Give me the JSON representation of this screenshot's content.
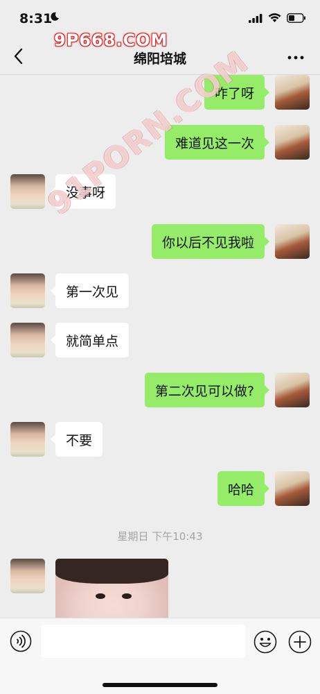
{
  "status_bar": {
    "time": "8:31"
  },
  "watermarks": {
    "top": "9P668.COM",
    "diagonal": "91PORN.COM"
  },
  "nav": {
    "title": "绵阳培城"
  },
  "messages": [
    {
      "side": "right",
      "text": "咋了呀"
    },
    {
      "side": "right",
      "text": "难道见这一次"
    },
    {
      "side": "left",
      "text": "没事呀"
    },
    {
      "side": "right",
      "text": "你以后不见我啦"
    },
    {
      "side": "left",
      "text": "第一次见"
    },
    {
      "side": "left",
      "text": "就简单点"
    },
    {
      "side": "right",
      "text": "第二次见可以做?"
    },
    {
      "side": "left",
      "text": "不要"
    },
    {
      "side": "right",
      "text": "哈哈"
    }
  ],
  "timestamp": "星期日 下午10:43",
  "colors": {
    "background": "#ededed",
    "outgoing_bubble": "#95ec69",
    "incoming_bubble": "#ffffff",
    "timestamp_text": "#a3a3a3"
  },
  "icons": {
    "back": "chevron-left-icon",
    "more": "more-icon",
    "voice": "voice-icon",
    "emoji": "emoji-icon",
    "plus": "plus-icon"
  }
}
